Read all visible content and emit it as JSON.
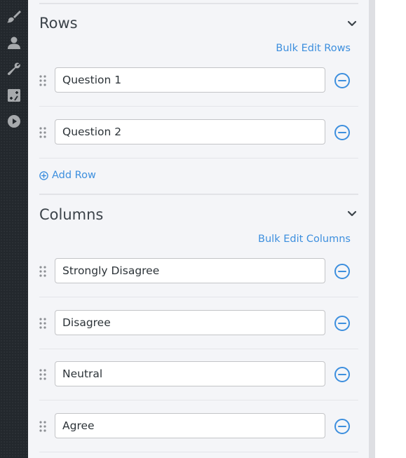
{
  "colors": {
    "accent": "#3d8fde",
    "sidebar": "#23282d",
    "panel": "#f4f5f8",
    "text": "#3c434a"
  },
  "sidebar": {
    "icons": [
      "paint-brush-icon",
      "user-icon",
      "wrench-icon",
      "plus-minus-icon",
      "play-icon"
    ]
  },
  "rows": {
    "title": "Rows",
    "bulk_edit_label": "Bulk Edit Rows",
    "items": [
      {
        "value": "Question 1"
      },
      {
        "value": "Question 2"
      }
    ],
    "add_label": "Add Row"
  },
  "columns": {
    "title": "Columns",
    "bulk_edit_label": "Bulk Edit Columns",
    "items": [
      {
        "value": "Strongly Disagree"
      },
      {
        "value": "Disagree"
      },
      {
        "value": "Neutral"
      },
      {
        "value": "Agree"
      }
    ]
  }
}
